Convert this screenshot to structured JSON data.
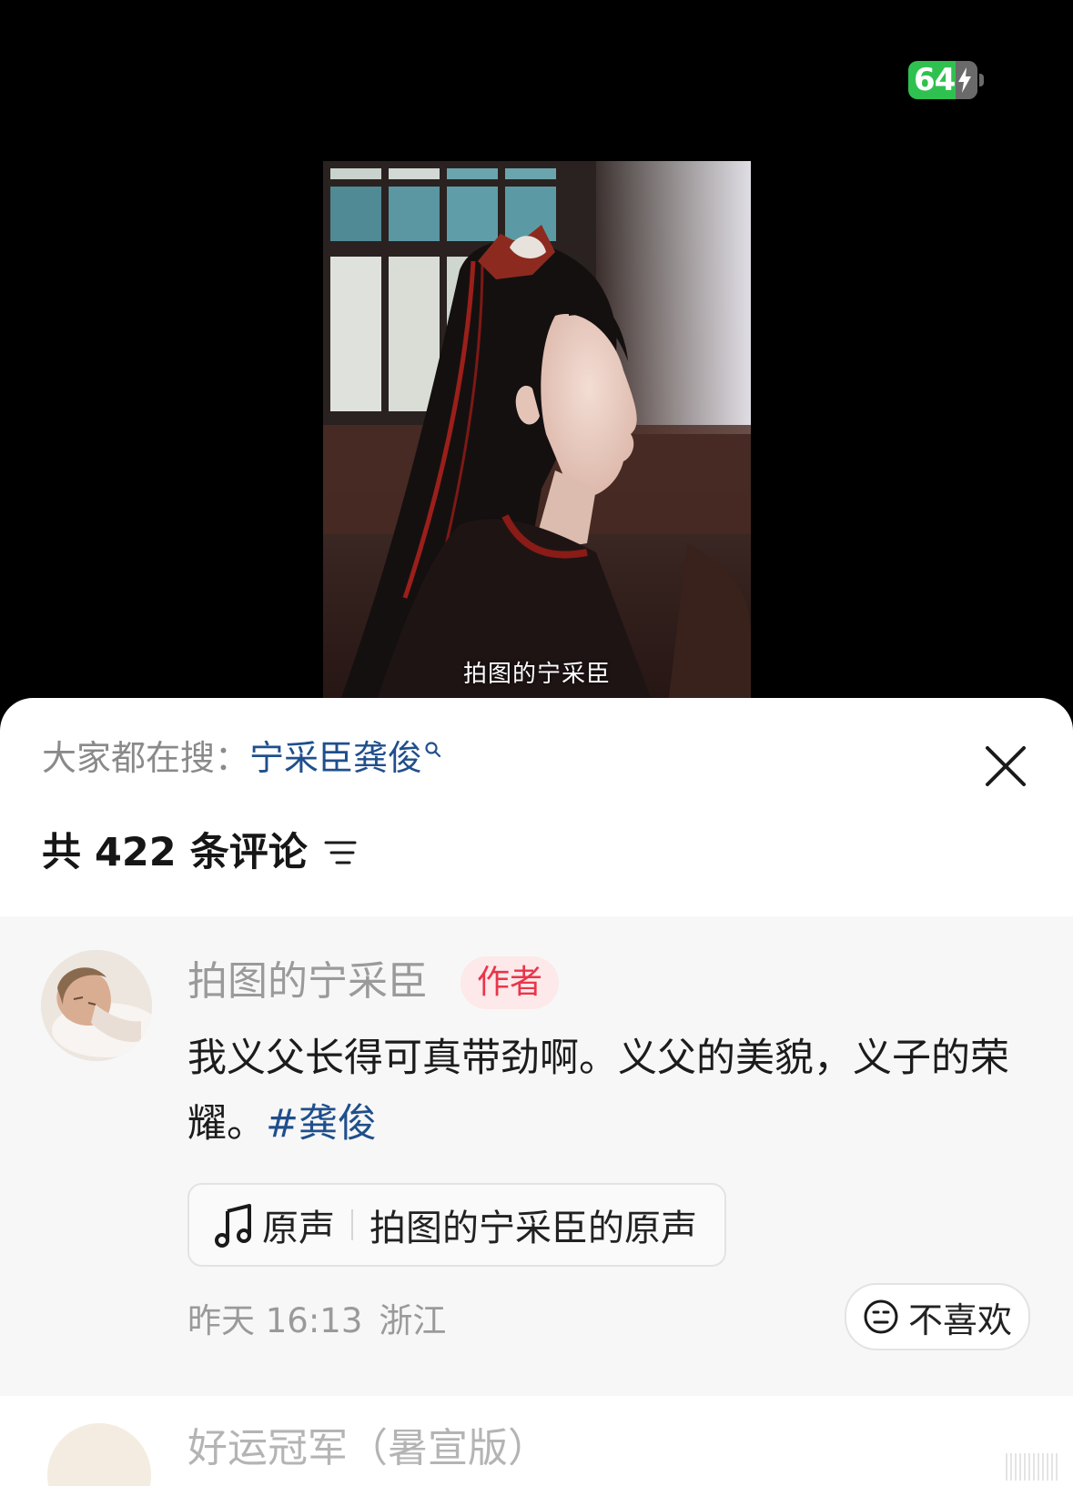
{
  "status_bar": {
    "battery_level": "64",
    "battery_color": "#2fc14f",
    "charging_icon": "bolt-icon"
  },
  "video": {
    "caption": "拍图的宁采臣"
  },
  "comment_sheet": {
    "search_prompt": {
      "label": "大家都在搜：",
      "term": "宁采臣龚俊",
      "icon": "search-icon"
    },
    "close_icon": "close-icon",
    "comment_count_text": "共 422 条评论",
    "sort_icon": "sort-icon",
    "comments": [
      {
        "author": "拍图的宁采臣",
        "badge": "作者",
        "text": "我义父长得可真带劲啊。义父的美貌，义子的荣耀。",
        "hashtag": "#龚俊",
        "audio": {
          "icon": "music-note-icon",
          "label": "原声",
          "title": "拍图的宁采臣的原声"
        },
        "time": "昨天 16:13",
        "location": "浙江",
        "dislike_label": "不喜欢",
        "dislike_icon": "meh-face-icon"
      },
      {
        "author": "好运冠军（暑宣版）"
      }
    ]
  },
  "colors": {
    "link_blue": "#1f4f8c",
    "badge_red": "#e8364a",
    "badge_bg": "#fde8ea"
  }
}
